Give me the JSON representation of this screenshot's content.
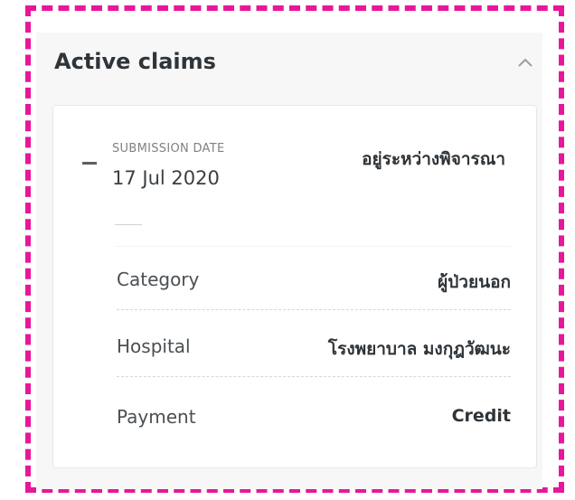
{
  "panel": {
    "title": "Active claims",
    "collapse_icon": "chevron-up-icon"
  },
  "claim": {
    "expand_icon": "minus-icon",
    "submission_label": "SUBMISSION DATE",
    "submission_date": "17 Jul 2020",
    "status": "อยู่ระหว่างพิจารณา",
    "details": [
      {
        "label": "Category",
        "value": "ผู้ป่วยนอก"
      },
      {
        "label": "Hospital",
        "value": "โรงพยาบาล มงกุฎวัฒนะ"
      },
      {
        "label": "Payment",
        "value": "Credit"
      }
    ]
  },
  "colors": {
    "frame_border": "#e8169a",
    "panel_background": "#f7f7f8",
    "card_background": "#ffffff"
  }
}
